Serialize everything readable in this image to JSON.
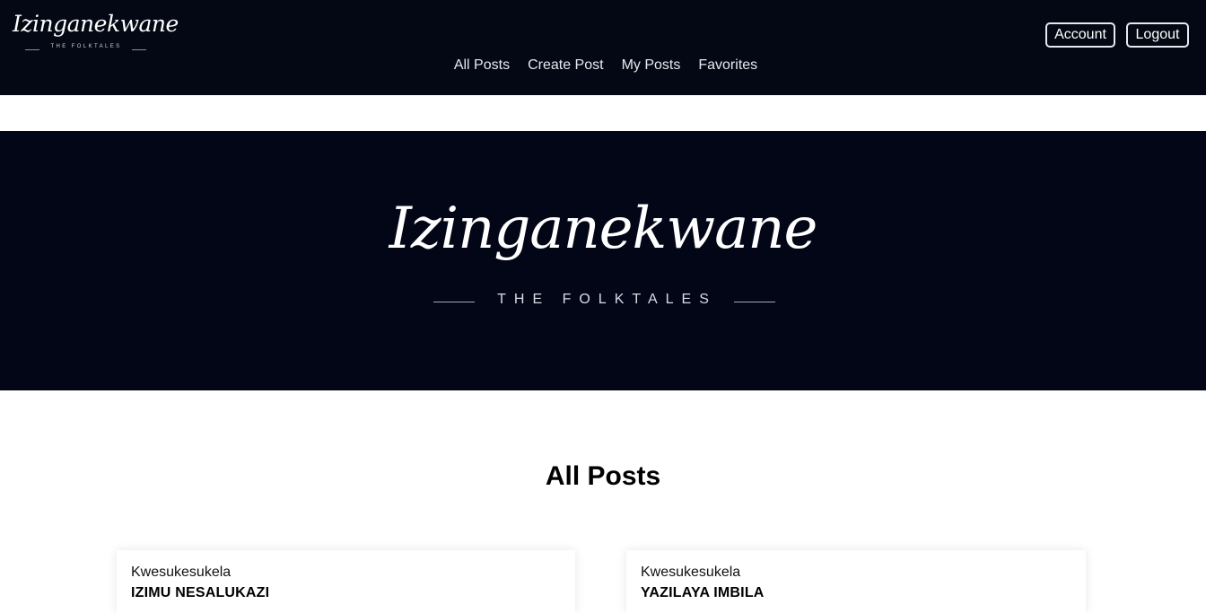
{
  "header": {
    "logo_script": "Izinganekwane",
    "logo_tagline": "THE FOLKTALES",
    "nav": [
      {
        "label": "All Posts"
      },
      {
        "label": "Create Post"
      },
      {
        "label": "My Posts"
      },
      {
        "label": "Favorites"
      }
    ],
    "account_label": "Account",
    "logout_label": "Logout"
  },
  "hero": {
    "script": "Izinganekwane",
    "tagline": "THE FOLKTALES"
  },
  "main": {
    "section_title": "All Posts",
    "posts": [
      {
        "category": "Kwesukesukela",
        "title": "IZIMU NESALUKAZI"
      },
      {
        "category": "Kwesukesukela",
        "title": "YAZILAYA IMBILA"
      }
    ]
  },
  "colors": {
    "header_bg": "#040814",
    "hero_bg": "#030617",
    "text_light": "#ffffff"
  }
}
